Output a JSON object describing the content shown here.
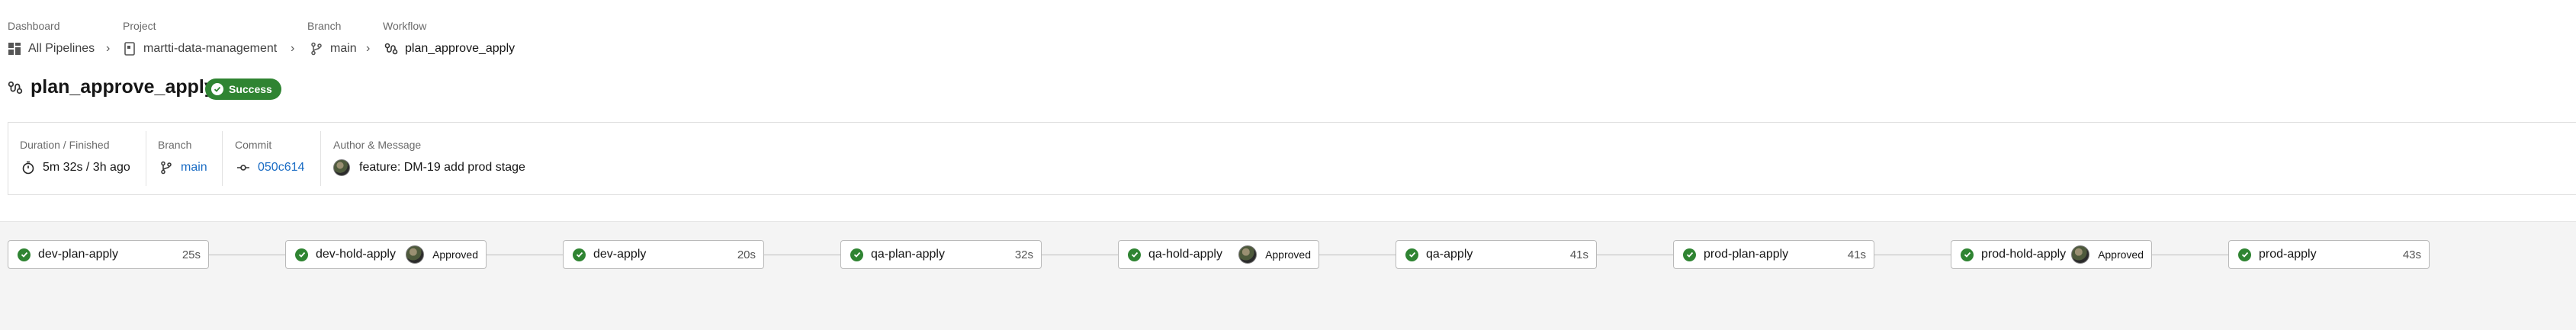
{
  "breadcrumb": {
    "dashboard": {
      "heading": "Dashboard",
      "value": "All Pipelines",
      "icon": "dashboard-grid-icon"
    },
    "project": {
      "heading": "Project",
      "value": "martti-data-management",
      "icon": "project-file-icon"
    },
    "branch": {
      "heading": "Branch",
      "value": "main",
      "icon": "git-branch-icon"
    },
    "workflow": {
      "heading": "Workflow",
      "value": "plan_approve_apply",
      "icon": "workflow-icon"
    }
  },
  "header": {
    "title": "plan_approve_apply",
    "status": "Success",
    "status_color": "#2f8432"
  },
  "summary": {
    "duration": {
      "label": "Duration / Finished",
      "value": "5m 32s / 3h ago",
      "icon": "timer-icon"
    },
    "branch": {
      "label": "Branch",
      "value": "main",
      "icon": "git-branch-icon"
    },
    "commit": {
      "label": "Commit",
      "value": "050c614",
      "icon": "commit-icon"
    },
    "author": {
      "label": "Author & Message",
      "value": "feature: DM-19 add prod stage",
      "icon": "avatar"
    }
  },
  "jobs": [
    {
      "name": "dev-plan-apply",
      "duration": "25s",
      "status": "success"
    },
    {
      "name": "dev-hold-apply",
      "approved": "Approved",
      "status": "success"
    },
    {
      "name": "dev-apply",
      "duration": "20s",
      "status": "success"
    },
    {
      "name": "qa-plan-apply",
      "duration": "32s",
      "status": "success"
    },
    {
      "name": "qa-hold-apply",
      "approved": "Approved",
      "status": "success"
    },
    {
      "name": "qa-apply",
      "duration": "41s",
      "status": "success"
    },
    {
      "name": "prod-plan-apply",
      "duration": "41s",
      "status": "success"
    },
    {
      "name": "prod-hold-apply",
      "approved": "Approved",
      "status": "success"
    },
    {
      "name": "prod-apply",
      "duration": "43s",
      "status": "success"
    }
  ],
  "colors": {
    "success": "#2f8432",
    "link": "#1a6cc4"
  }
}
